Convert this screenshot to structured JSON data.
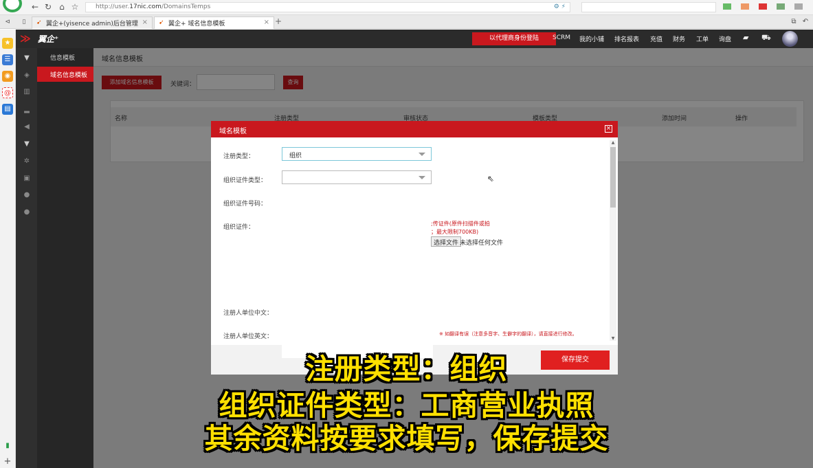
{
  "browser": {
    "url_prefix": "http://user.",
    "url_domain": "17nic.com",
    "url_path": "/DomainsTemps",
    "tabs": [
      {
        "label": "翼企+(yisence admin)后台管理"
      },
      {
        "label": "翼企+ 域名信息模板"
      }
    ],
    "tab_close": "×",
    "tab_add": "+"
  },
  "app": {
    "brand": "翼企⁺",
    "agent_login": "以代理商身份登陆",
    "topnav": [
      "SCRM",
      "我的小铺",
      "排名报表",
      "充值",
      "财务",
      "工单",
      "询盘"
    ],
    "menu_group": "信息模板",
    "menu_active": "域名信息模板"
  },
  "content": {
    "breadcrumb": "域名信息模板",
    "add_button": "添加域名信息模板",
    "keyword_label": "关键词：",
    "query_button": "查询",
    "table_headers": [
      "名称",
      "注册类型",
      "审核状态",
      "模板类型",
      "添加时间",
      "操作"
    ]
  },
  "modal": {
    "title": "域名模板",
    "close": "×",
    "fields": {
      "reg_type_label": "注册类型：",
      "reg_type_value": "组织",
      "cert_type_label": "组织证件类型：",
      "cert_type_value": "",
      "cert_no_label": "组织证件号码：",
      "cert_label": "组织证件：",
      "org_cn_label": "注册人单位中文：",
      "org_en_label": "注册人单位英文："
    },
    "upload_note_line1": ";传证件(原件扫描件或拍",
    "upload_note_line2": "；最大限制700KB)",
    "file_button": "选择文件",
    "file_status": "未选择任何文件",
    "notice": "※  如翻译有误（注意多音字、生僻字的翻译），请直接进行修改。",
    "save_button": "保存提交"
  },
  "subtitles": [
    "注册类型：组织",
    "组织证件类型：工商营业执照",
    "其余资料按要求填写，保存提交"
  ],
  "colors": {
    "accent_red": "#c9181e",
    "subtitle_yellow": "#ffe000"
  }
}
